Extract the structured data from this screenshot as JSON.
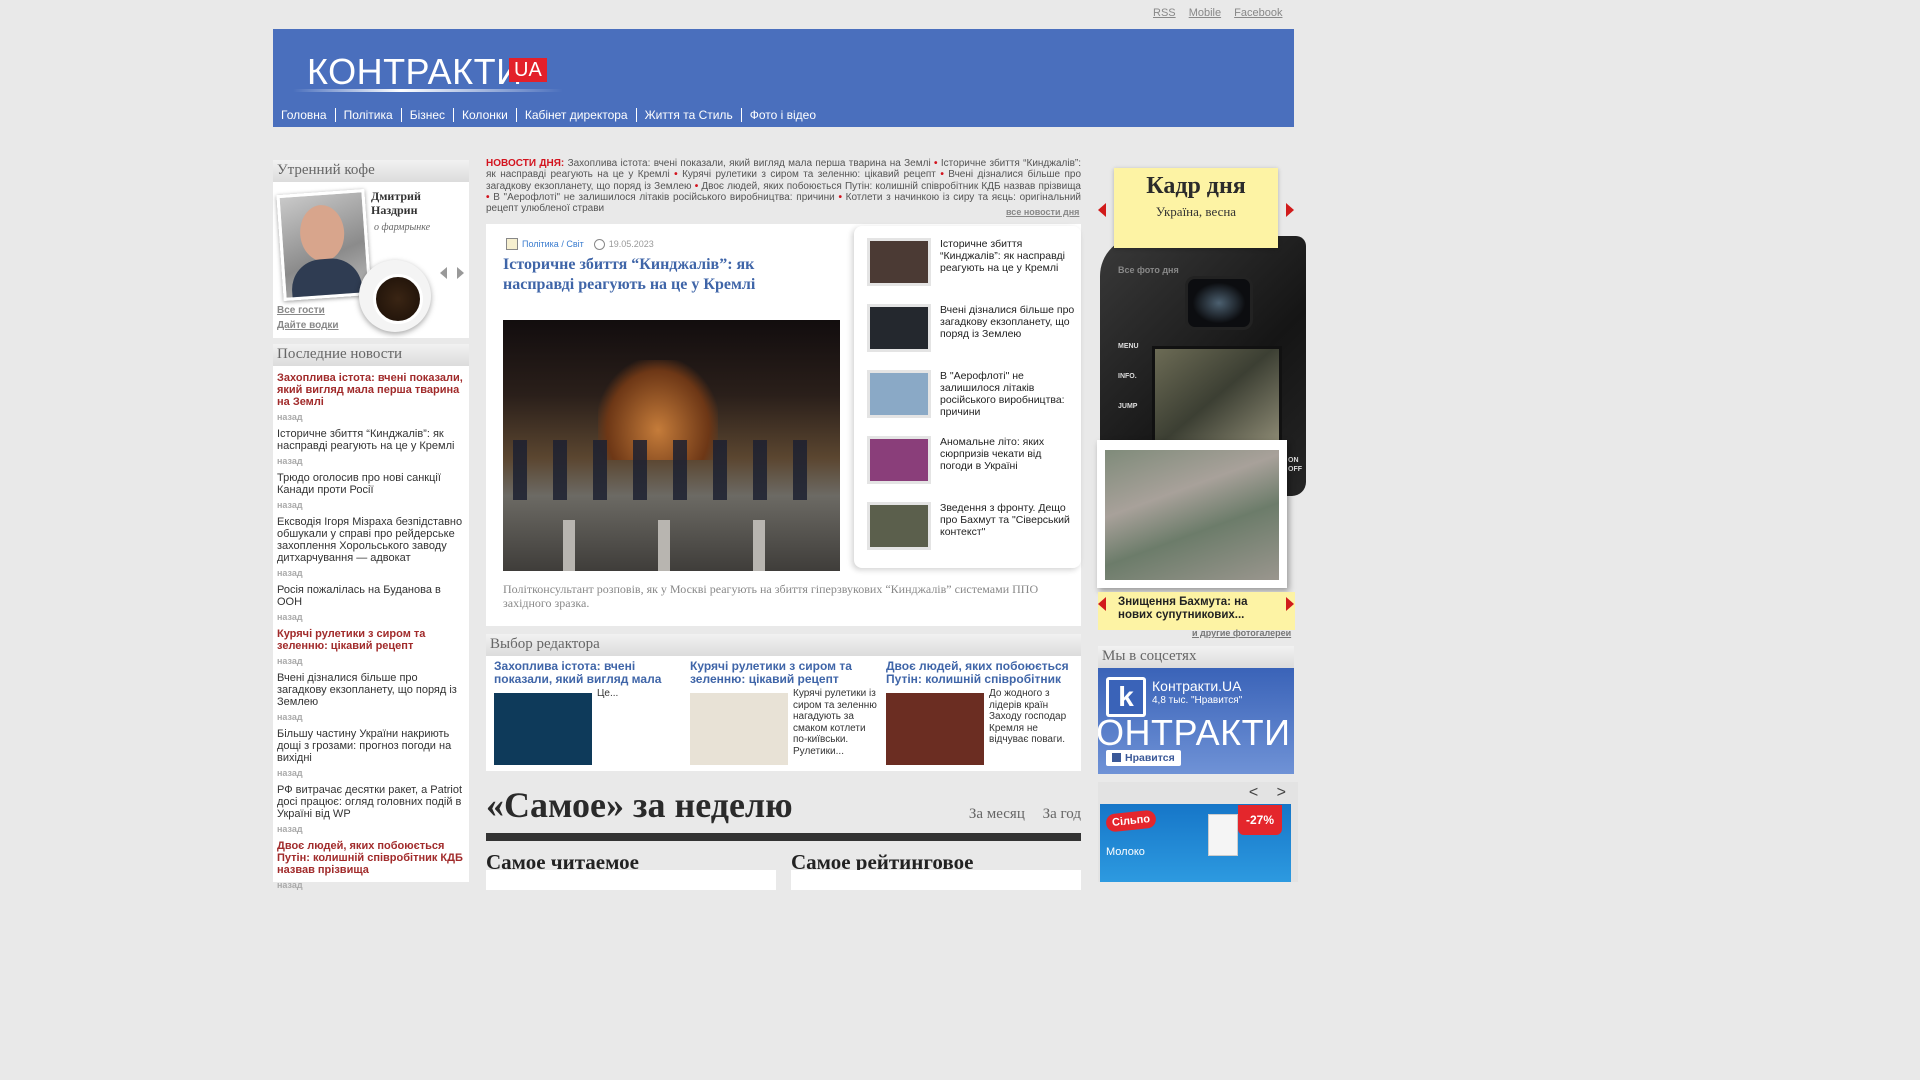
{
  "top_links": [
    "RSS",
    "Mobile",
    "Facebook"
  ],
  "logo": {
    "text": "КОНТРАКТИ",
    "badge": "UA"
  },
  "nav": [
    "Головна",
    "Політика",
    "Бізнес",
    "Колонки",
    "Кабінет директора",
    "Життя та Стиль",
    "Фото і відео"
  ],
  "morning": {
    "header": "Утренний кофе",
    "author": "Дмитрий Наздрин",
    "topic": "о фармрынке",
    "all_guests": "Все гости",
    "give_water": "Дайте водки"
  },
  "latest": {
    "header": "Последние новости",
    "ago_label": "назад",
    "items": [
      {
        "text": "Захоплива істота: вчені показали, який вигляд мала перша тварина на Землі",
        "highlight": true
      },
      {
        "text": "Історичне збиття “Кинджалів”: як насправді реагують на це у Кремлі",
        "highlight": false
      },
      {
        "text": "Трюдо оголосив про нові санкції Канади проти Росії",
        "highlight": false
      },
      {
        "text": "Ексводія Ігоря Мізраха безпідставно обшукали у справі про рейдерське захоплення Хорольського заводу дитхарчування — адвокат",
        "highlight": false
      },
      {
        "text": "Росія пожалілась на Буданова в ООН",
        "highlight": false
      },
      {
        "text": "Курячі рулетики з сиром та зеленню: цікавий рецепт",
        "highlight": true
      },
      {
        "text": "Вчені дізналися більше про загадкову екзопланету, що поряд із Землею",
        "highlight": false
      },
      {
        "text": "Більшу частину України накриють дощі з грозами: прогноз погоди на вихідні",
        "highlight": false
      },
      {
        "text": "РФ витрачає десятки ракет, а Patriot досі працює: огляд головних подій в Україні від WP",
        "highlight": false
      },
      {
        "text": "Двоє людей, яких побоюється Путін: колишній співробітник КДБ назвав прізвища",
        "highlight": true
      }
    ]
  },
  "day_news": {
    "label": "НОВОСТИ ДНЯ:",
    "items": [
      "Захоплива істота: вчені показали, який вигляд мала перша тварина на Землі",
      "Історичне збиття “Кинджалів”: як насправді реагують на це у Кремлі",
      "Курячі рулетики з сиром та зеленню: цікавий рецепт",
      "Вчені дізналися більше про загадкову екзопланету, що поряд із Землею",
      "Двоє людей, яких побоюється Путін: колишній співробітник КДБ назвав прізвища",
      "В \"Аерофлоті\" не залишилося літаків російського виробництва: причини",
      "Котлети з начинкою із сиру та яєць: оригінальний рецепт улюбленої страви"
    ],
    "all_link": "все новости дня"
  },
  "main_story": {
    "category": "Політика / Світ",
    "date": "19.05.2023",
    "title": "Історичне збиття “Кинджалів”: як насправді реагують на це у Кремлі",
    "caption": "Політконсультант розповів, як у Москві реагують на збиття гіперзвукових “Кинджалів” системами ППО західного зразка."
  },
  "side_stories": [
    {
      "title": "Історичне збиття “Кинджалів”: як насправді реагують на це у Кремлі",
      "thumb": "#4b3a34"
    },
    {
      "title": "Вчені дізналися більше про загадкову екзопланету, що поряд із Землею",
      "thumb": "#24282e"
    },
    {
      "title": "В \"Аерофлоті\" не залишилося літаків російського виробництва: причини",
      "thumb": "#8aa9c6"
    },
    {
      "title": "Аномальне літо: яких сюрпризів чекати від погоди в Україні",
      "thumb": "#8a3e7a"
    },
    {
      "title": "Зведення з фронту. Дещо про Бахмут та \"Сіверський контекст\"",
      "thumb": "#5b5f4c"
    }
  ],
  "editor": {
    "header": "Выбор редактора",
    "items": [
      {
        "title": "Захоплива істота: вчені показали, який вигляд мала",
        "text": "Це...",
        "img": "#0e3a5a"
      },
      {
        "title": "Курячі рулетики з сиром та зеленню: цікавий рецепт",
        "text": "Курячі рулетики із сиром та зеленню нагадують за смаком котлети по-київськи. Рулетики...",
        "img": "#e8e2d6"
      },
      {
        "title": "Двоє людей, яких побоюється Путін: колишній співробітник",
        "text": "До жодного з лідерів країн Заходу господар Кремля не відчуває поваги.",
        "img": "#6b2d22"
      }
    ]
  },
  "week": {
    "title": "«Самое» за неделю",
    "links": [
      "За месяц",
      "За год"
    ],
    "most_read": "Самое читаемое",
    "top_rated": "Самое рейтинговое"
  },
  "kadr": {
    "title": "Кадр дня",
    "subtitle": "Україна, весна",
    "all_photos": "Все фото дня",
    "camera_buttons": [
      "MENU",
      "INFO.",
      "JUMP"
    ],
    "camera_onoff": "ON OFF",
    "gallery_title": "Знищення Бахмута: на нових супутникових...",
    "other_galleries": "и другие фотогалереи"
  },
  "social": {
    "header": "Мы в соцсетях",
    "page_name": "Контракти.UA",
    "likes": "4,8 тыс. \"Нравится\"",
    "cover_text": "ОНТРАКТИ",
    "like_button": "Нравится",
    "icon_letter": "k"
  },
  "ad": {
    "prev": "<",
    "next": ">",
    "brand": "Сільпо",
    "discount": "-27%",
    "product": "Молоко"
  },
  "colors": {
    "header_blue": "#4a6fbd",
    "accent_red": "#d3131e",
    "link_blue": "#3f65a8",
    "note_yellow": "#fdf3a4"
  }
}
